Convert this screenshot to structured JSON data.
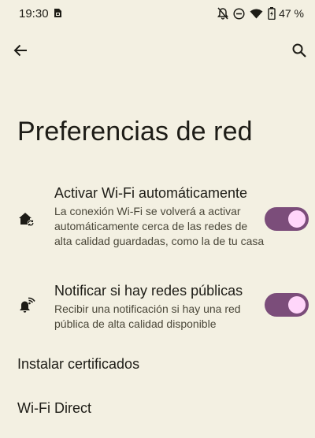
{
  "status_bar": {
    "time": "19:30",
    "battery_percent": "47 %",
    "icons": [
      "sim-card-icon",
      "notifications-off-icon",
      "do-not-disturb-icon",
      "wifi-icon",
      "battery-charging-icon"
    ]
  },
  "app_bar": {
    "back_icon": "arrow-back-icon",
    "search_icon": "search-icon"
  },
  "page": {
    "title": "Preferencias de red"
  },
  "settings": [
    {
      "icon": "home-wifi-auto-icon",
      "title": "Activar Wi-Fi automáticamente",
      "summary": "La conexión Wi-Fi se volverá a activar automáticamente cerca de las redes de alta calidad guardadas, como la de tu casa",
      "enabled": true
    },
    {
      "icon": "notification-wifi-icon",
      "title": "Notificar si hay redes públicas",
      "summary": "Recibir una notificación si hay una red pública de alta calidad disponible",
      "enabled": true
    }
  ],
  "items": [
    {
      "label": "Instalar certificados"
    },
    {
      "label": "Wi-Fi Direct"
    }
  ],
  "colors": {
    "background": "#f3f0e2",
    "switch_track": "#7b4d7a",
    "switch_thumb": "#ffd6fa",
    "text_primary": "#1d1c16",
    "text_secondary": "#4a4739"
  }
}
